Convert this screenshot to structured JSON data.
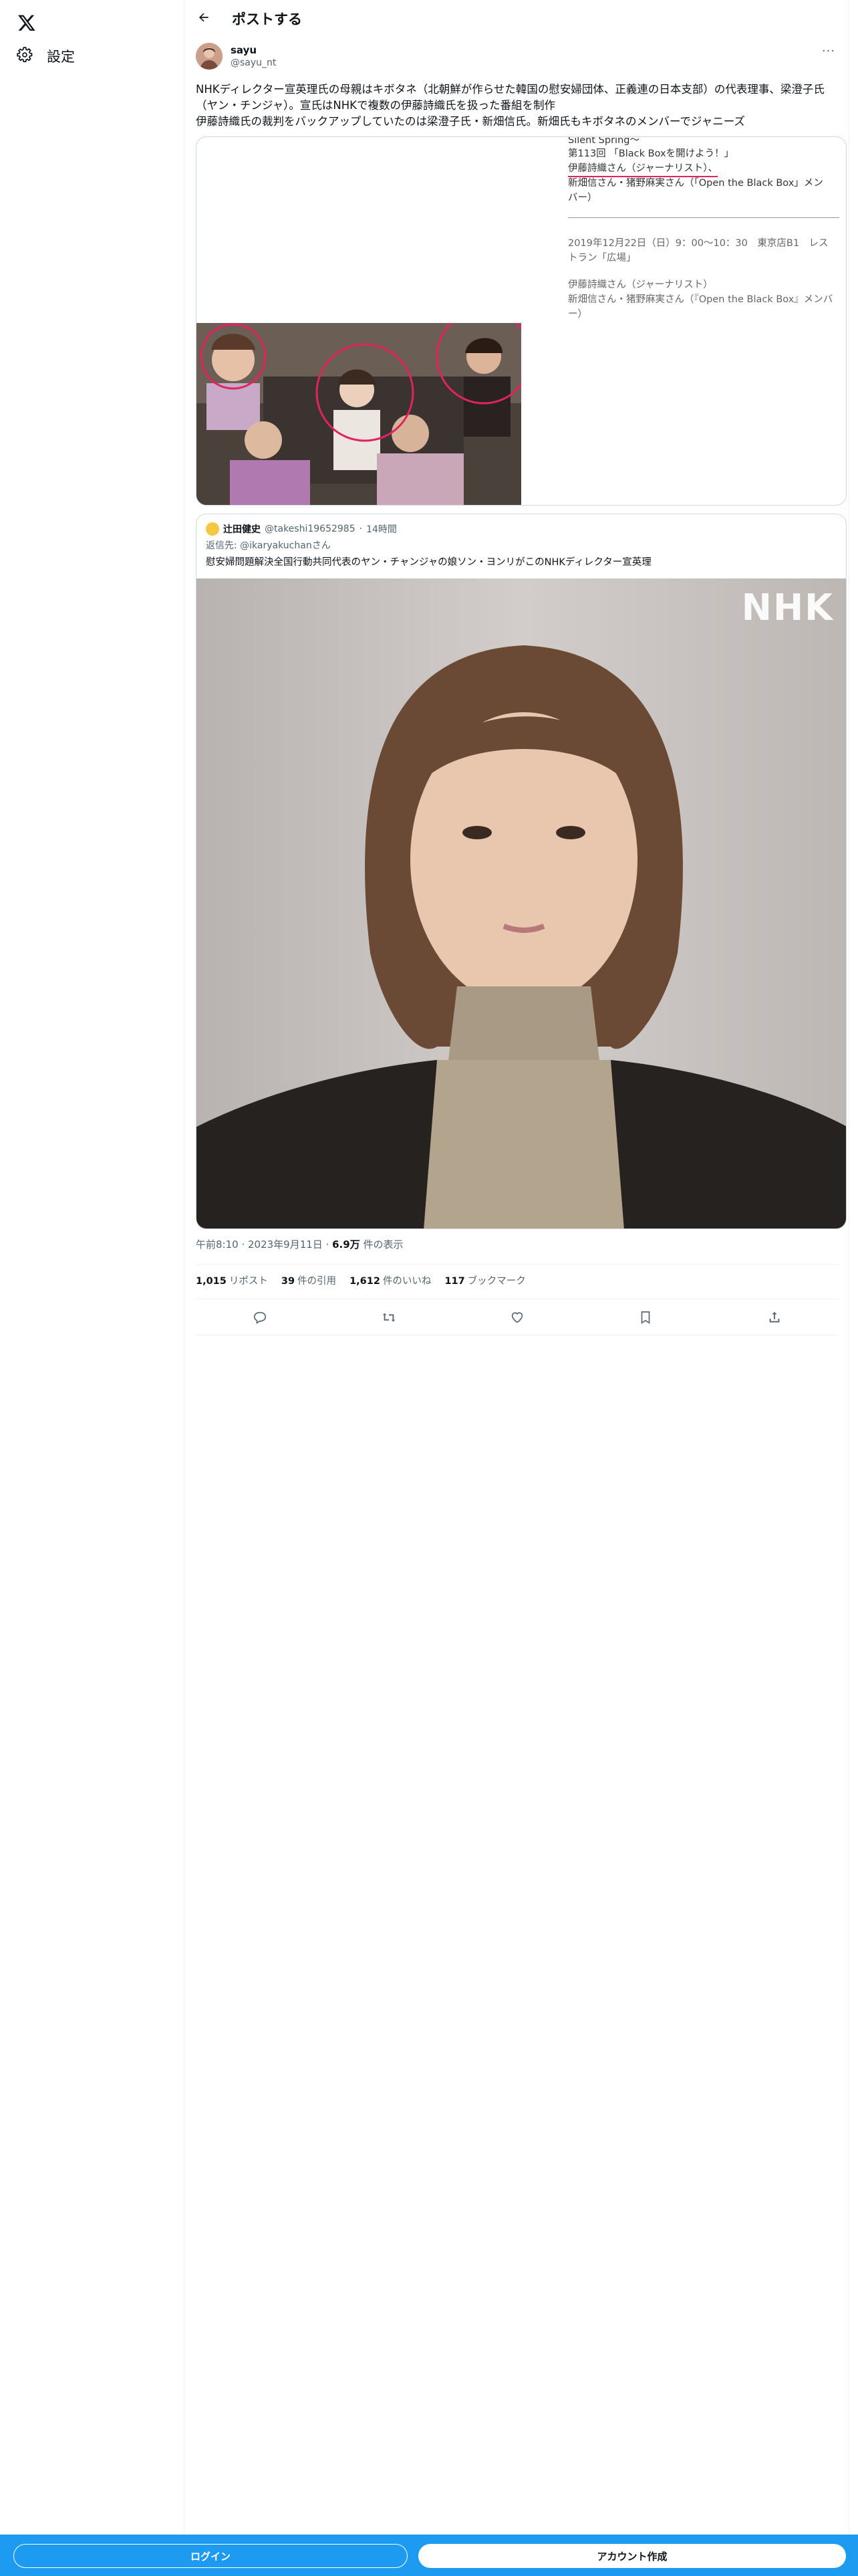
{
  "nav": {
    "settings_label": "設定",
    "logo_icon": "x-logo-icon"
  },
  "header": {
    "title": "ポストする"
  },
  "post": {
    "author_name": "sayu",
    "author_handle": "@sayu_nt",
    "text_lines": [
      "NHKディレクター宣英理氏の母親はキボタネ（北朝鮮が作らせた韓国の慰安婦団体、正義連の日本支部）の代表理事、梁澄子氏",
      "（ヤン・チンジャ）。宣氏はNHKで複数の伊藤詩織氏を扱った番組を制作",
      "伊藤詩織氏の裁判をバックアップしていたのは梁澄子氏・新畑信氏。新畑氏もキボタネのメンバーでジャニーズ"
    ],
    "media_doc_lines": [
      "Silent Spring〜",
      "第113回 「Black Boxを開けよう！」",
      "伊藤詩織さん（ジャーナリスト）、",
      "新畑信さん・猪野麻実さん（「Open the Black Box」メン",
      "バー）",
      "2019年12月22日（日）9：00〜10：30　東京店B1　レス",
      "トラン「広場」",
      "伊藤詩織さん（ジャーナリスト）",
      "新畑信さん・猪野麻実さん（『Open the Black Box』メンバ",
      "ー）"
    ],
    "timestamp": "午前8:10 · 2023年9月11日 · ",
    "views_count": "6.9万",
    "views_label": " 件の表示",
    "stats": [
      {
        "count": "1,015",
        "label": "リポスト"
      },
      {
        "count": "39",
        "label": "件の引用"
      },
      {
        "count": "1,612",
        "label": "件のいいね"
      },
      {
        "count": "117",
        "label": "ブックマーク"
      }
    ]
  },
  "quote": {
    "author_name": "辻田健史",
    "author_handle": "@takeshi19652985",
    "time": "14時間",
    "reply_to": "返信先: @ikaryakuchanさん",
    "text": "慰安婦問題解決全国行動共同代表のヤン・チャンジャの娘ソン・ヨンリがこのNHKディレクター宣英理",
    "image_watermark": "NHK"
  },
  "actions": [
    "reply-icon",
    "repost-icon",
    "like-icon",
    "bookmark-icon",
    "share-icon"
  ],
  "footer": {
    "login_label": "ログイン",
    "signup_label": "アカウント作成"
  },
  "colors": {
    "accent": "#1d9bf0",
    "text": "#0f1419",
    "muted": "#536471",
    "border": "#cfd9de",
    "highlight": "#e0245e"
  }
}
